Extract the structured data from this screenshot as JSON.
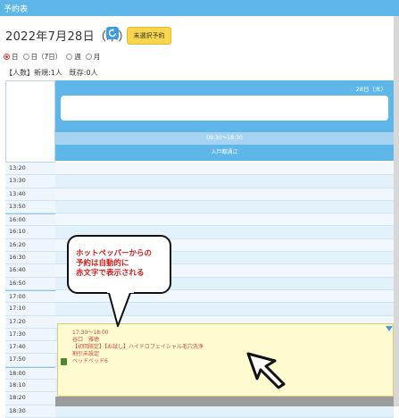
{
  "window": {
    "title": "予約表"
  },
  "header": {
    "date_title": "2022年7月28日（木）",
    "unassigned_label": "未選択予約"
  },
  "view_options": [
    {
      "label": "日",
      "selected": true
    },
    {
      "label": "日（7日）",
      "selected": false
    },
    {
      "label": "週",
      "selected": false
    },
    {
      "label": "月",
      "selected": false
    }
  ],
  "people_count": "【人数】新規:1人　既存:0人",
  "schedule": {
    "date_label": "28日（木）",
    "business_hours": "09:30〜18:30",
    "staff_name": "入戸都涌江",
    "times": [
      "13:20",
      "13:30",
      "13:40",
      "13:50",
      "16:00",
      "16:10",
      "16:20",
      "16:30",
      "16:40",
      "16:50",
      "17:00",
      "17:10",
      "17:20",
      "17:30",
      "17:40",
      "17:50",
      "18:00",
      "18:10",
      "18:20",
      "18:30"
    ]
  },
  "booking": {
    "time": "17:30〜18:00",
    "customer": "谷口　雅徳",
    "menu": "【初回限定】【お試し】ハイドロフェイシャル毛穴洗浄",
    "status": "割引未設定",
    "bed": "ベッドベッド6"
  },
  "callout": {
    "line1": "ホットペッパーからの",
    "line2": "予約は自動的に",
    "line3": "赤文字で表示される"
  },
  "colors": {
    "accent": "#5fb6e8",
    "booking_bg": "#fffbd0",
    "callout_text": "#d41c1c"
  }
}
